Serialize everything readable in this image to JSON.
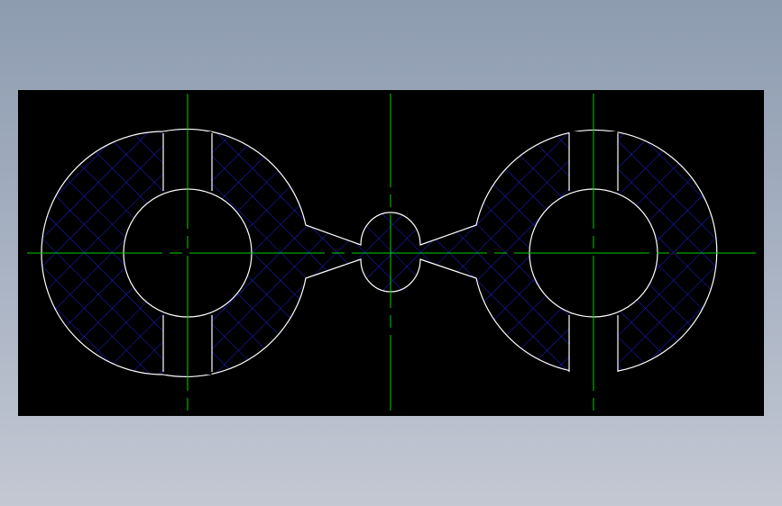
{
  "viewport": {
    "background": "#000000"
  },
  "colors": {
    "outline": "#ffffff",
    "centerline": "#00d000",
    "hatch": "#1f1fd9",
    "page_gradient_top": "#8e9cb0",
    "page_gradient_bottom": "#c3c8d3"
  },
  "drawing": {
    "features": [
      "left-ring",
      "right-ring",
      "center-hub",
      "connecting-web",
      "left-slot",
      "right-slot"
    ],
    "hatch_pattern": "crosshatch"
  }
}
